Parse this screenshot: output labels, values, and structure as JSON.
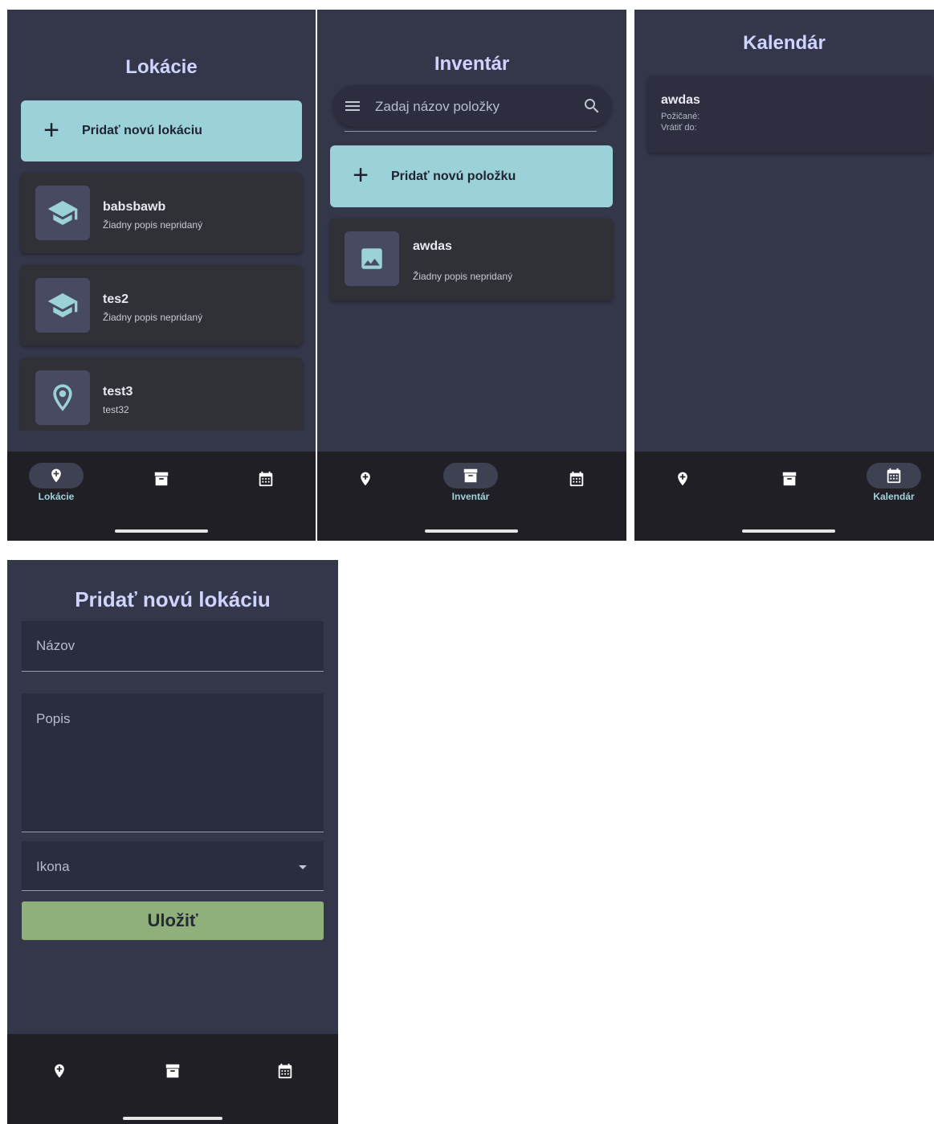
{
  "locations_screen": {
    "title": "Lokácie",
    "add_label": "Pridať novú lokáciu",
    "items": [
      {
        "name": "babsbawb",
        "description": "Žiadny popis nepridaný",
        "icon": "school-icon"
      },
      {
        "name": "tes2",
        "description": "Žiadny popis nepridaný",
        "icon": "school-icon"
      },
      {
        "name": "test3",
        "description": "test32",
        "icon": "location-pin-icon"
      }
    ]
  },
  "inventory_screen": {
    "title": "Inventár",
    "search_placeholder": "Zadaj názov položky",
    "add_label": "Pridať novú položku",
    "items": [
      {
        "name": "awdas",
        "description": "Žiadny popis nepridaný",
        "icon": "image-icon"
      }
    ]
  },
  "calendar_screen": {
    "title": "Kalendár",
    "items": [
      {
        "name": "awdas",
        "borrowed_label": "Požičané:",
        "return_label": "Vrátiť do:"
      }
    ]
  },
  "add_location_screen": {
    "title": "Pridať novú lokáciu",
    "name_label": "Názov",
    "description_label": "Popis",
    "icon_label": "Ikona",
    "save_label": "Uložiť"
  },
  "nav": {
    "locations": "Lokácie",
    "inventory": "Inventár",
    "calendar": "Kalendár"
  },
  "colors": {
    "background": "#343649",
    "accent": "#9bd2da",
    "title": "#cfd4ff",
    "save": "#8fb07b",
    "navbar": "#1f1f25"
  }
}
